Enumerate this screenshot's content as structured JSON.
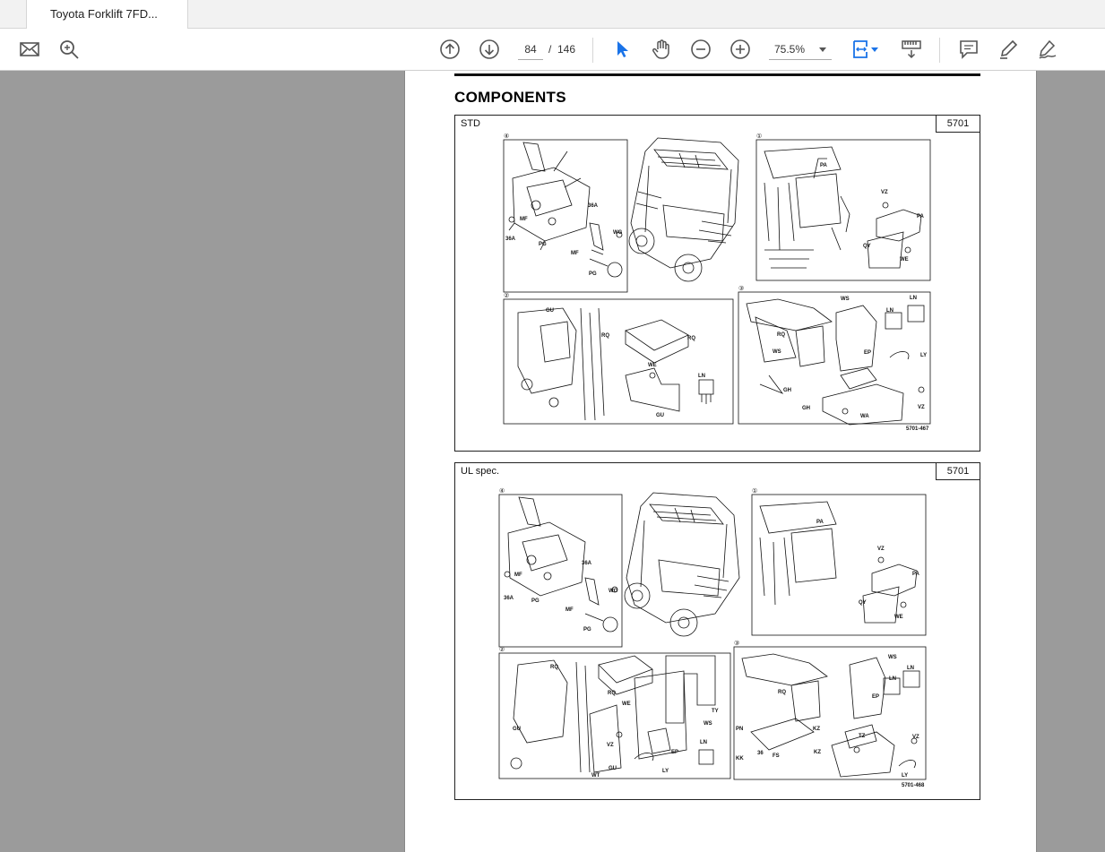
{
  "tab": {
    "title": "Toyota Forklift 7FD..."
  },
  "toolbar": {
    "page_current": "84",
    "page_separator": "/",
    "page_total": "146",
    "zoom": "75.5%"
  },
  "document": {
    "heading": "COMPONENTS",
    "panels": [
      {
        "label": "STD",
        "code": "5701",
        "ref": "5701-467",
        "callouts": {
          "a": [
            "④",
            "MF",
            "36A",
            "36A",
            "WG",
            "PG",
            "MF",
            "PG"
          ],
          "b": [
            "①",
            "PA",
            "VZ",
            "PA",
            "QY",
            "WE"
          ],
          "c": [
            "②",
            "GU",
            "RQ",
            "RQ",
            "WE",
            "GU",
            "LN"
          ],
          "d": [
            "③",
            "WS",
            "LN",
            "LN",
            "RQ",
            "WS",
            "EP",
            "LY",
            "GH",
            "GH",
            "WA",
            "VZ"
          ]
        }
      },
      {
        "label": "UL spec.",
        "code": "5701",
        "ref": "5701-468",
        "callouts": {
          "a": [
            "④",
            "MF",
            "36A",
            "36A",
            "WG",
            "PG",
            "MF",
            "PG"
          ],
          "b": [
            "①",
            "PA",
            "VZ",
            "PA",
            "QY",
            "WE"
          ],
          "c": [
            "②",
            "RQ",
            "RQ",
            "WE",
            "GU",
            "VZ",
            "TY",
            "WS",
            "EP",
            "GU",
            "WT",
            "LY",
            "LN"
          ],
          "d": [
            "③",
            "WS",
            "LN",
            "LN",
            "RQ",
            "EP",
            "PN",
            "KZ",
            "TZ",
            "VZ",
            "KK",
            "36",
            "FS",
            "KZ",
            "LY"
          ]
        }
      }
    ]
  },
  "icons": {
    "mail": "mail-icon",
    "search": "search-icon",
    "prev": "arrow-up-circle-icon",
    "next": "arrow-down-circle-icon",
    "select": "cursor-icon",
    "hand": "hand-icon",
    "zoom_out": "zoom-out-icon",
    "zoom_in": "zoom-in-icon",
    "fit": "fit-width-icon",
    "scroll": "scroll-mode-icon",
    "comment": "comment-icon",
    "highlight": "highlight-icon",
    "sign": "sign-icon"
  },
  "colors": {
    "accent": "#1a73e8",
    "page_bg": "#9b9b9b"
  }
}
